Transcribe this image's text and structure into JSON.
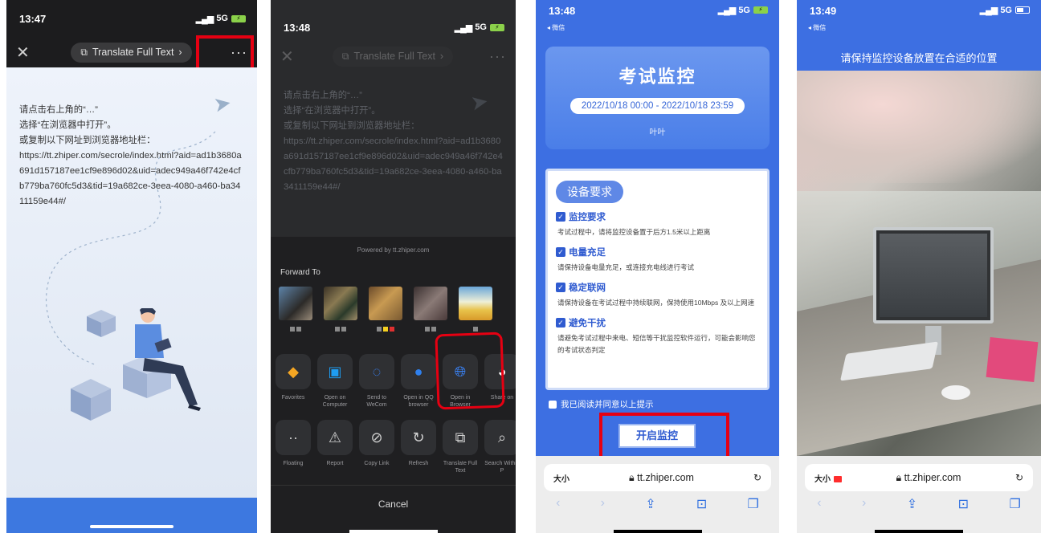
{
  "phone1": {
    "time": "13:47",
    "network": "5G",
    "close_icon": "close-icon",
    "translate_label": "Translate Full Text",
    "more_label": "···",
    "instructions": "请点击右上角的“…”\n选择“在浏览器中打开”。\n或复制以下网址到浏览器地址栏：\nhttps://tt.zhiper.com/secrole/index.html?aid=ad1b3680a691d157187ee1cf9e896d02&uid=adec949a46f742e4cfb779ba760fc5d3&tid=19a682ce-3eea-4080-a460-ba3411159e44#/"
  },
  "phone2": {
    "time": "13:48",
    "network": "5G",
    "translate_label": "Translate Full Text",
    "instructions": "请点击右上角的“…”\n选择“在浏览器中打开”。\n或复制以下网址到浏览器地址栏：\nhttps://tt.zhiper.com/secrole/index.html?aid=ad1b3680a691d157187ee1cf9e896d02&uid=adec949a46f742e4cfb779ba760fc5d3&tid=19a682ce-3eea-4080-a460-ba3411159e44#/",
    "powered_by": "Powered by tt.zhiper.com",
    "forward_to": "Forward To",
    "share_row1": [
      {
        "label": "Favorites",
        "icon": "cube-icon",
        "color": "#f5a623"
      },
      {
        "label": "Open on Computer",
        "icon": "monitor-icon",
        "color": "#1e9df2"
      },
      {
        "label": "Send to WeCom",
        "icon": "wecom-icon",
        "color": "#3a86ff"
      },
      {
        "label": "Open in QQ browser",
        "icon": "qq-browser-icon",
        "color": "#2f80ed"
      },
      {
        "label": "Open in Browser",
        "icon": "globe-icon",
        "color": "#3a86ff"
      },
      {
        "label": "Share on",
        "icon": "qq-icon",
        "color": "#ffffff"
      }
    ],
    "share_row2": [
      {
        "label": "Floating",
        "icon": "floating-icon"
      },
      {
        "label": "Report",
        "icon": "warning-icon"
      },
      {
        "label": "Copy Link",
        "icon": "link-icon"
      },
      {
        "label": "Refresh",
        "icon": "refresh-icon"
      },
      {
        "label": "Translate Full Text",
        "icon": "translate-icon"
      },
      {
        "label": "Search Within P",
        "icon": "search-icon"
      }
    ],
    "cancel": "Cancel"
  },
  "phone3": {
    "time": "13:48",
    "back_label": "◂ 微信",
    "network": "5G",
    "title": "考试监控",
    "date_range": "2022/10/18 00:00 - 2022/10/18 23:59",
    "name": "叶叶",
    "requirements_badge": "设备要求",
    "requirements": [
      {
        "title": "监控要求",
        "desc": "考试过程中，请将监控设备置于后方1.5米以上距离"
      },
      {
        "title": "电量充足",
        "desc": "请保持设备电量充足，或连接充电线进行考试"
      },
      {
        "title": "稳定联网",
        "desc": "请保持设备在考试过程中持续联网，保持使用10Mbps 及以上网速"
      },
      {
        "title": "避免干扰",
        "desc": "请避免考试过程中来电、短信等干扰监控软件运行，可能会影响您的考试状态判定"
      }
    ],
    "agree": "我已阅读并同意以上提示",
    "start_button": "开启监控",
    "text_size": "大小",
    "url": "tt.zhiper.com"
  },
  "phone4": {
    "time": "13:49",
    "back_label": "◂ 微信",
    "network": "5G",
    "camera_hint": "请保持监控设备放置在合适的位置",
    "text_size": "大小",
    "url": "tt.zhiper.com"
  }
}
